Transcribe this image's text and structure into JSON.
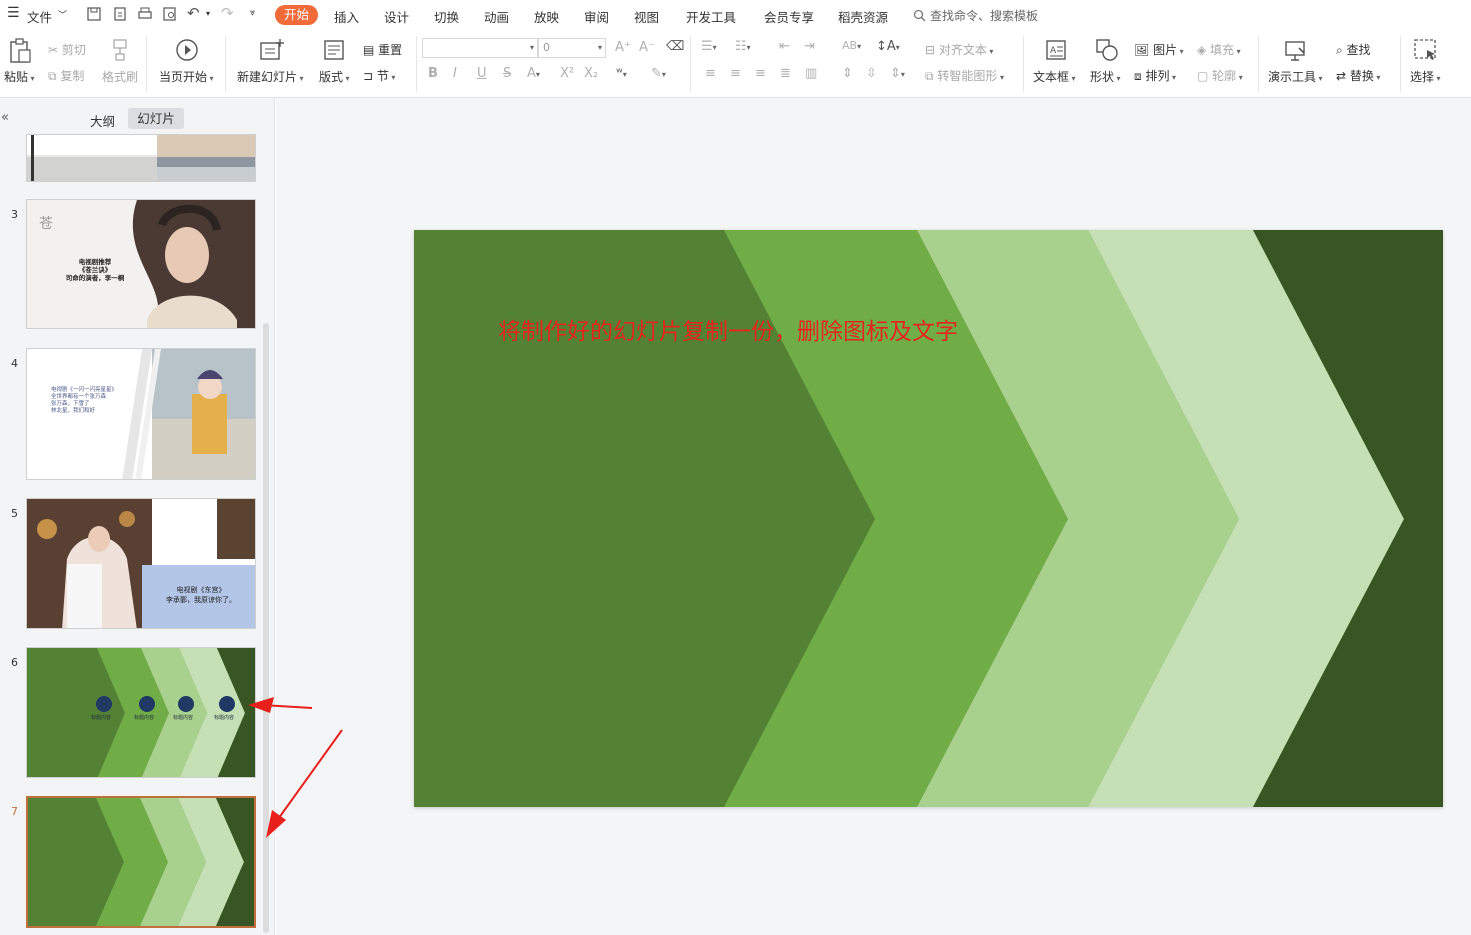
{
  "menubar": {
    "file": "文件",
    "tabs": [
      "开始",
      "插入",
      "设计",
      "切换",
      "动画",
      "放映",
      "审阅",
      "视图",
      "开发工具",
      "会员专享",
      "稻壳资源"
    ],
    "search_placeholder": "查找命令、搜索模板"
  },
  "ribbon": {
    "paste": "粘贴",
    "cut": "剪切",
    "copy": "复制",
    "format_painter": "格式刷",
    "play_from_current": "当页开始",
    "new_slide": "新建幻灯片",
    "layout": "版式",
    "reset": "重置",
    "section": "节",
    "font_size_value": "0",
    "align_text": "对齐文本",
    "convert_smartart": "转智能图形",
    "textbox": "文本框",
    "shape": "形状",
    "picture": "图片",
    "arrange": "排列",
    "fill": "填充",
    "outline": "轮廓",
    "presentation_tools": "演示工具",
    "find": "查找",
    "replace": "替换",
    "select": "选择"
  },
  "left_panel": {
    "tab_outline": "大纲",
    "tab_slides": "幻灯片",
    "slide_numbers": [
      "3",
      "4",
      "5",
      "6",
      "7"
    ],
    "slide3_text": [
      "电视剧推荐",
      "《苍兰诀》",
      "司命的演者，李一桐"
    ],
    "slide4_text": [
      "电视剧《一闪一闪亮星星》",
      "全世界都有一个张万森",
      "张万森，下雪了",
      "林北星，我们和好"
    ],
    "slide5_text": [
      "电视剧《东宫》",
      "李承鄞，我原谅你了。"
    ],
    "slide6_labels": [
      "标题内容",
      "标题内容",
      "标题内容",
      "标题内容"
    ]
  },
  "slide": {
    "note": "将制作好的幻灯片复制一份，删除图标及文字"
  },
  "colors": {
    "accent": "#f06a3a",
    "green_dark": "#548235",
    "green_mid": "#70ad47",
    "green_light": "#a9d18e",
    "green_pale": "#c5e0b4",
    "green_deep": "#375623",
    "note_red": "#e6261c",
    "selection_border": "#c0703a"
  }
}
